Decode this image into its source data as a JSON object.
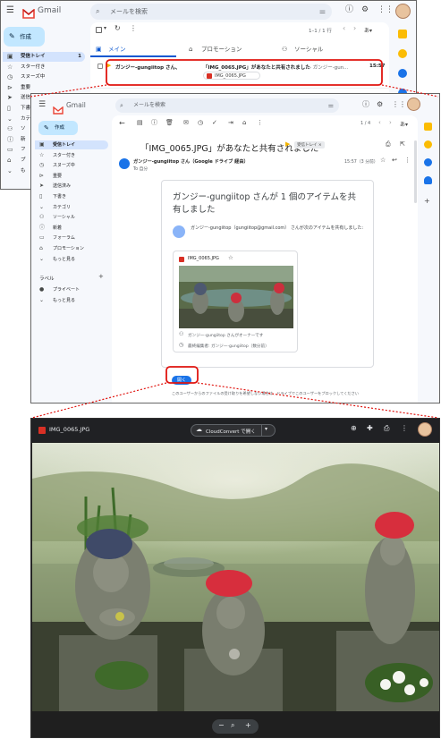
{
  "inbox": {
    "app_name": "Gmail",
    "search_placeholder": "メールを検索",
    "compose": "作成",
    "nav": [
      {
        "label": "受信トレイ",
        "count": "1",
        "icon": "inbox-icon"
      },
      {
        "label": "スター付き",
        "icon": "star-icon"
      },
      {
        "label": "スヌーズ中",
        "icon": "clock-icon"
      },
      {
        "label": "重要",
        "icon": "label-icon"
      },
      {
        "label": "送信済み",
        "icon": "send-icon"
      },
      {
        "label": "下書き",
        "icon": "draft-icon"
      },
      {
        "label": "カテゴリ",
        "icon": "category-icon"
      },
      {
        "label": "ソ",
        "icon": "people-icon"
      },
      {
        "label": "新",
        "icon": "info-icon"
      },
      {
        "label": "フ",
        "icon": "forum-icon"
      },
      {
        "label": "プ",
        "icon": "tag-icon"
      },
      {
        "label": "も",
        "icon": "chevron-down-icon"
      }
    ],
    "pagination": "1–1 / 1 行",
    "tabs": [
      "メイン",
      "プロモーション",
      "ソーシャル"
    ],
    "message": {
      "sender": "ガンジー-gungiitop さん、",
      "subject": "「IMG_0065.JPG」があなたと共有されました",
      "snippet": " - ガンジー-gun...",
      "time": "15:57",
      "attachment": "IMG_0065.JPG"
    }
  },
  "message_view": {
    "app_name": "Gmail",
    "search_placeholder": "メールを検索",
    "compose": "作成",
    "nav": [
      {
        "label": "受信トレイ",
        "icon": "inbox-icon"
      },
      {
        "label": "スター付き",
        "icon": "star-icon"
      },
      {
        "label": "スヌーズ中",
        "icon": "clock-icon"
      },
      {
        "label": "重要",
        "icon": "label-icon"
      },
      {
        "label": "送信済み",
        "icon": "send-icon"
      },
      {
        "label": "下書き",
        "icon": "draft-icon"
      },
      {
        "label": "カテゴリ",
        "icon": "category-icon"
      },
      {
        "label": "ソーシャル",
        "icon": "people-icon"
      },
      {
        "label": "新着",
        "icon": "info-icon"
      },
      {
        "label": "フォーラム",
        "icon": "forum-icon"
      },
      {
        "label": "プロモーション",
        "icon": "tag-icon"
      },
      {
        "label": "もっと見る",
        "icon": "chevron-down-icon"
      }
    ],
    "labels_heading": "ラベル",
    "labels": [
      {
        "label": "プライベート",
        "icon": "label-dot-icon"
      },
      {
        "label": "もっと見る",
        "icon": "chevron-down-icon"
      }
    ],
    "pagination": "1 / 4",
    "subject": "「IMG_0065.JPG」があなたと共有されました",
    "badge": "受信トレイ ×",
    "sender": "ガンジー-gungiitop さん（Google ドライブ 経由）",
    "to": "To 自分",
    "time": "15:57（3 分前）",
    "card": {
      "title": "ガンジー-gungiitop さんが 1 個のアイテムを共有しました",
      "body": "ガンジー-gungiitop（gungiitop@gmail.com） さんが次のアイテムを共有しました:",
      "file_name": "IMG_0065.JPG",
      "owner": "ガンジー-gungiitop さんがオーナーです",
      "edited": "最終編集者: ガンジー-gungiitop（数分前）",
      "open_button": "開く",
      "footer": "このユーザーからのファイルの受け取りを希望しない場合は、ドライブでこのユーザーをブロックしてください"
    }
  },
  "viewer": {
    "file_name": "IMG_0065.JPG",
    "open_with": "CloudConvert で開く",
    "zoom_minus": "−",
    "zoom_plus": "+"
  },
  "colors": {
    "highlight_red": "#e0140f",
    "gmail_blue": "#0b57d0",
    "compose_bg": "#c2e7ff"
  }
}
